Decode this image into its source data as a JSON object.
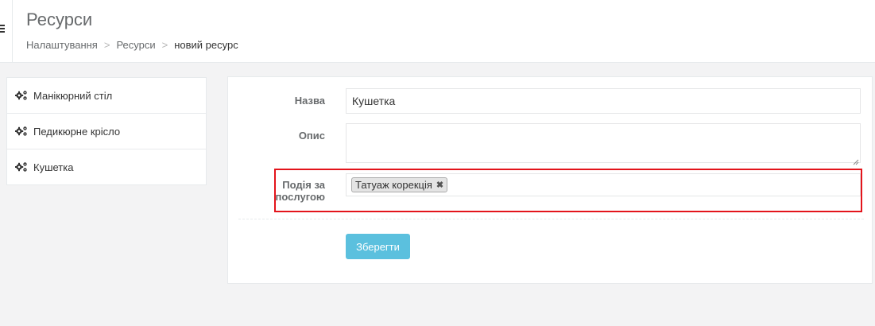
{
  "header": {
    "title": "Ресурси",
    "breadcrumb": [
      "Налаштування",
      "Ресурси",
      "новий ресурс"
    ],
    "breadcrumb_separator": ">"
  },
  "sidebar": {
    "items": [
      {
        "label": "Манікюрний стіл",
        "icon": "gears-icon"
      },
      {
        "label": "Педикюрне крісло",
        "icon": "gears-icon"
      },
      {
        "label": "Кушетка",
        "icon": "gears-icon"
      }
    ]
  },
  "form": {
    "name_label": "Назва",
    "name_value": "Кушетка",
    "description_label": "Опис",
    "description_value": "",
    "event_label_line1": "Подія за",
    "event_label_line2": "послугою",
    "selected_tags": [
      "Татуаж корекція"
    ],
    "tag_remove_symbol": "✖",
    "save_label": "Зберегти"
  },
  "colors": {
    "accent": "#5bc0de",
    "highlight": "#e3141b",
    "background": "#f3f3f4"
  }
}
